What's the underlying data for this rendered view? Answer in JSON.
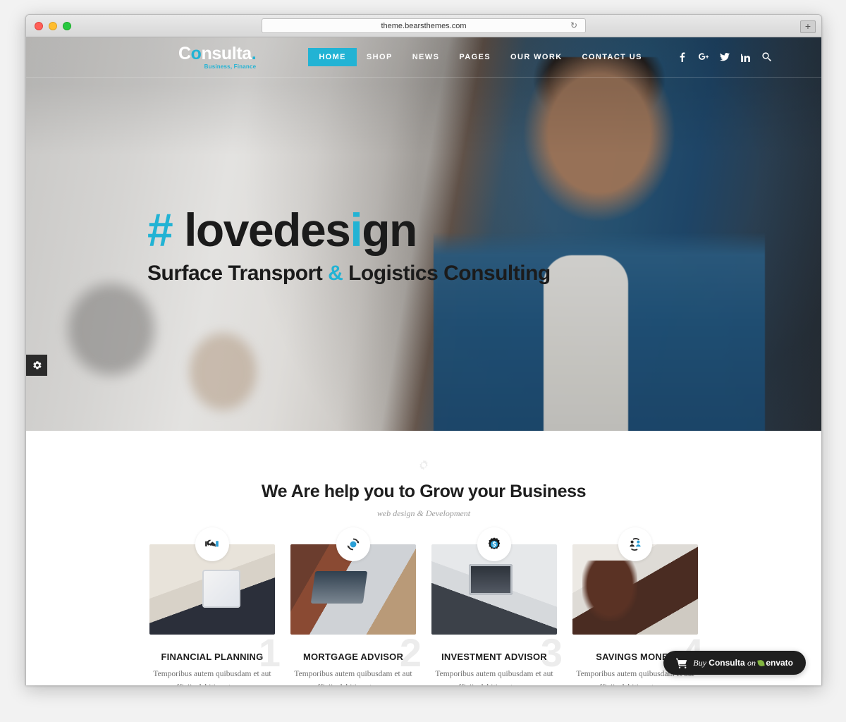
{
  "browser": {
    "url": "theme.bearsthemes.com",
    "reload_icon": "reload-icon",
    "newtab_label": "+",
    "traffic_lights": [
      "close",
      "minimize",
      "maximize"
    ]
  },
  "site": {
    "logo": {
      "part1": "C",
      "accent_letter": "o",
      "part2": "nsulta",
      "dot": ".",
      "tagline": "Business, Finance"
    },
    "nav": [
      {
        "label": "HOME",
        "active": true
      },
      {
        "label": "SHOP",
        "active": false
      },
      {
        "label": "NEWS",
        "active": false
      },
      {
        "label": "PAGES",
        "active": false
      },
      {
        "label": "OUR WORK",
        "active": false
      },
      {
        "label": "CONTACT US",
        "active": false
      }
    ],
    "social": [
      {
        "name": "facebook-icon",
        "glyph": "f"
      },
      {
        "name": "google-plus-icon",
        "glyph": "G+"
      },
      {
        "name": "twitter-icon",
        "glyph": "twitter"
      },
      {
        "name": "linkedin-icon",
        "glyph": "in"
      },
      {
        "name": "search-icon",
        "glyph": "search"
      }
    ],
    "accent_color": "#22b3d4",
    "dark_color": "#1b1b1b"
  },
  "hero": {
    "headline_hash": "#",
    "headline_a": "lovedes",
    "headline_i": "i",
    "headline_b": "gn",
    "sub_a": "Surface Transport ",
    "sub_amp": "&",
    "sub_b": " Logistics Consulting",
    "settings_icon": "gear-icon"
  },
  "services": {
    "deco_icon": "gear-outline-icon",
    "title": "We Are help you to Grow your Business",
    "subtitle": "web design & Development",
    "cards": [
      {
        "number": "1",
        "title": "FINANCIAL PLANNING",
        "text": "Temporibus autem quibusdam et aut officiis debitis aut rerum",
        "icon": "handshake-icon"
      },
      {
        "number": "2",
        "title": "MORTGAGE ADVISOR",
        "text": "Temporibus autem quibusdam et aut officiis debitis aut rerum",
        "icon": "refresh-circle-icon"
      },
      {
        "number": "3",
        "title": "INVESTMENT ADVISOR",
        "text": "Temporibus autem quibusdam et aut officiis debitis aut rerum",
        "icon": "dollar-badge-icon"
      },
      {
        "number": "4",
        "title": "SAVINGS MONEY",
        "text": "Temporibus autem quibusdam et aut officiis debitis aut rerum",
        "icon": "people-exchange-icon"
      }
    ]
  },
  "buy_button": {
    "cart_icon": "cart-icon",
    "buy": "Buy",
    "product": "Consulta",
    "on": "on",
    "marketplace": "envato"
  }
}
